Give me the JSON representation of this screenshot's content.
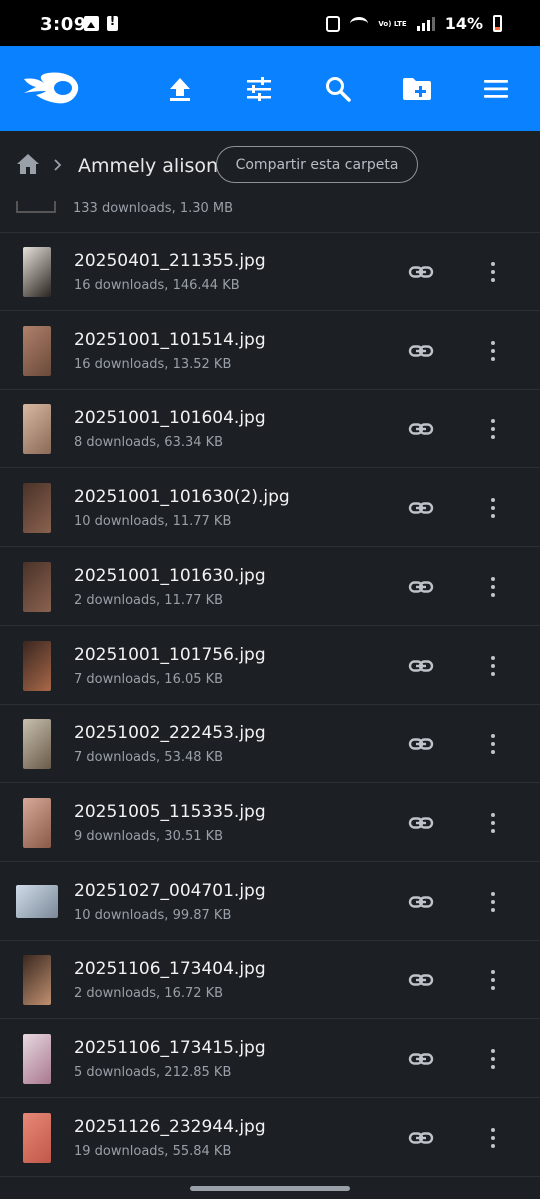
{
  "status_bar": {
    "time": "3:09",
    "battery": "14%",
    "network_label": "Vo) LTE"
  },
  "app_bar": {
    "brand_color": "#0a82ff",
    "icons": [
      "upload-icon",
      "filter-icon",
      "search-icon",
      "add-folder-icon",
      "menu-icon"
    ]
  },
  "breadcrumb": {
    "folder_name": "Ammely alison",
    "share_label": "Compartir esta carpeta"
  },
  "list": {
    "partial_meta": "133 downloads, 1.30 MB",
    "files": [
      {
        "name": "20250401_211355.jpg",
        "meta": "16 downloads, 146.44 KB",
        "thumb": [
          "#e6e2da",
          "#2a2420"
        ]
      },
      {
        "name": "20251001_101514.jpg",
        "meta": "16 downloads, 13.52 KB",
        "thumb": [
          "#b0806a",
          "#6a4a3a"
        ]
      },
      {
        "name": "20251001_101604.jpg",
        "meta": "8 downloads, 63.34 KB",
        "thumb": [
          "#d8b8a0",
          "#8a6a58"
        ]
      },
      {
        "name": "20251001_101630(2).jpg",
        "meta": "10 downloads, 11.77 KB",
        "thumb": [
          "#4a3228",
          "#8a6250"
        ]
      },
      {
        "name": "20251001_101630.jpg",
        "meta": "2 downloads, 11.77 KB",
        "thumb": [
          "#4a3228",
          "#8a6250"
        ]
      },
      {
        "name": "20251001_101756.jpg",
        "meta": "7 downloads, 16.05 KB",
        "thumb": [
          "#3a2620",
          "#a86848"
        ]
      },
      {
        "name": "20251002_222453.jpg",
        "meta": "7 downloads, 53.48 KB",
        "thumb": [
          "#c8c0b0",
          "#6a5a48"
        ]
      },
      {
        "name": "20251005_115335.jpg",
        "meta": "9 downloads, 30.51 KB",
        "thumb": [
          "#d8a898",
          "#8a5a48"
        ]
      },
      {
        "name": "20251027_004701.jpg",
        "meta": "10 downloads, 99.87 KB",
        "thumb": [
          "#d0dce8",
          "#7a8898"
        ],
        "wide": true
      },
      {
        "name": "20251106_173404.jpg",
        "meta": "2 downloads, 16.72 KB",
        "thumb": [
          "#3a2820",
          "#c09070"
        ]
      },
      {
        "name": "20251106_173415.jpg",
        "meta": "5 downloads, 212.85 KB",
        "thumb": [
          "#e8d8e0",
          "#a87890"
        ]
      },
      {
        "name": "20251126_232944.jpg",
        "meta": "19 downloads, 55.84 KB",
        "thumb": [
          "#e88878",
          "#c05848"
        ]
      }
    ]
  }
}
